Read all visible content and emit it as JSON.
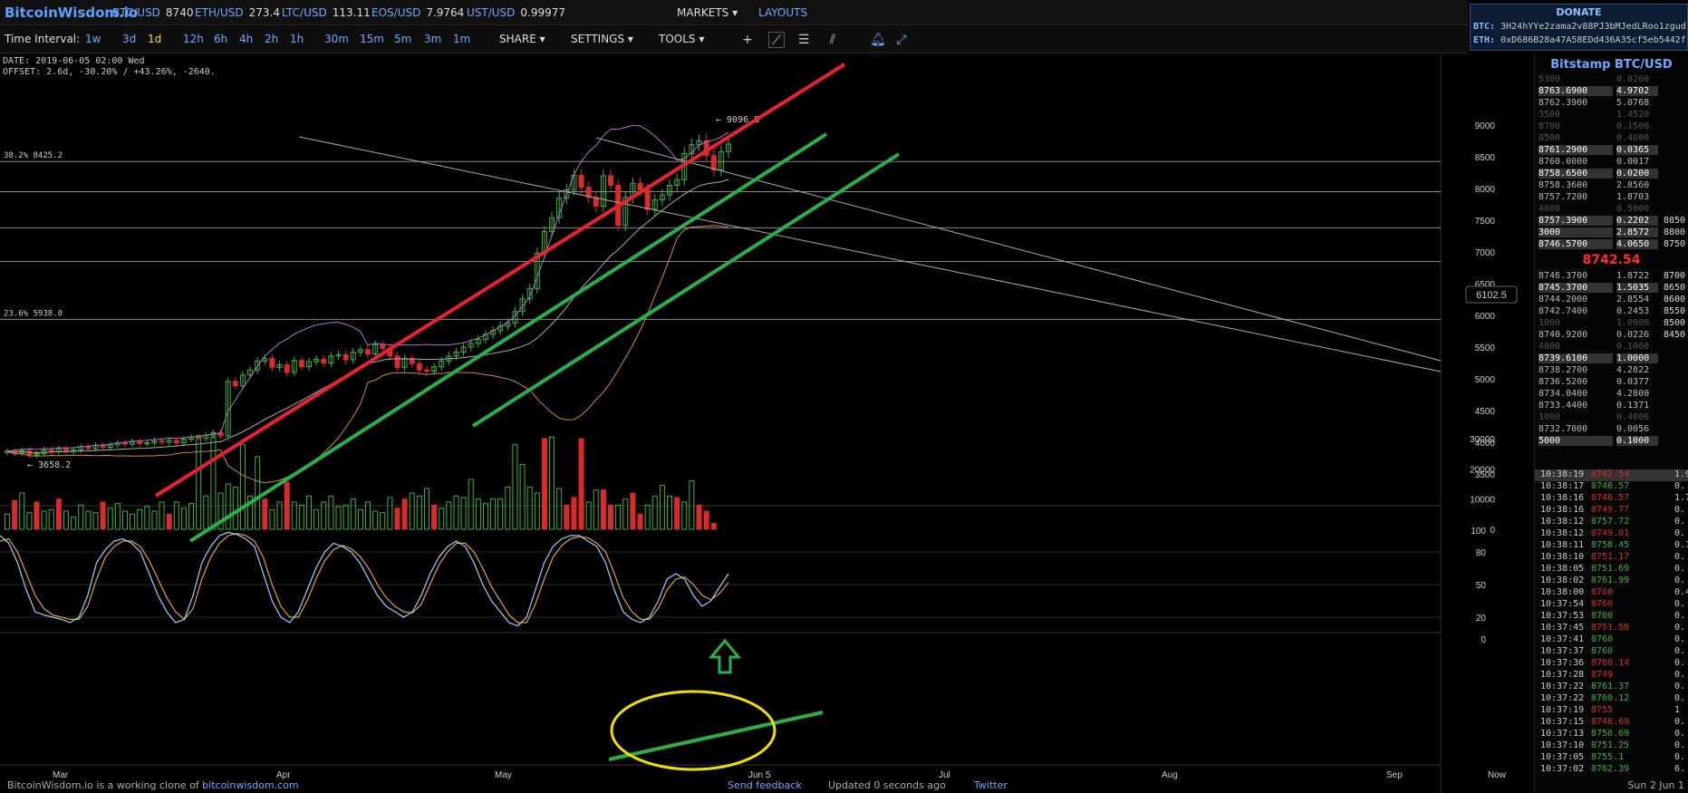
{
  "header": {
    "logo": "BitcoinWisdom.io",
    "tickers": [
      {
        "sym": "BTC/USD",
        "val": "8740"
      },
      {
        "sym": "ETH/USD",
        "val": "273.4"
      },
      {
        "sym": "LTC/USD",
        "val": "113.11"
      },
      {
        "sym": "EOS/USD",
        "val": "7.9764"
      },
      {
        "sym": "UST/USD",
        "val": "0.99977"
      }
    ],
    "markets": "MARKETS",
    "layouts": "LAYOUTS"
  },
  "donate": {
    "title": "DONATE",
    "btc_label": "BTC:",
    "btc_addr": "3H24hYYe2zama2v88PJ3bMJedLRoo1zgud",
    "eth_label": "ETH:",
    "eth_addr": "0xD686B28a47A58EDd436A35cf5eb5442f"
  },
  "toolbar": {
    "interval_label": "Time Interval:",
    "intervals": [
      "1w",
      "3d",
      "1d",
      "12h",
      "6h",
      "4h",
      "2h",
      "1h",
      "30m",
      "15m",
      "5m",
      "3m",
      "1m"
    ],
    "active_interval": "1d",
    "menus": [
      "SHARE",
      "SETTINGS",
      "TOOLS"
    ]
  },
  "chart_info": {
    "date_line": "DATE: 2019-06-05 02:00 Wed",
    "offset_line": "OFFSET: 2.6d, -30.20% / +43.26%, -2640."
  },
  "chart_data": {
    "type": "candlestick",
    "x_labels": [
      "Mar",
      "Apr",
      "May",
      "Jun 5",
      "Jul",
      "Aug",
      "Sep",
      "Now"
    ],
    "price_axis": [
      9000,
      8500,
      8000,
      7500,
      7000,
      6500,
      6000,
      5500,
      5000,
      4500,
      4000,
      3500
    ],
    "volume_axis": [
      30000,
      20000,
      10000,
      0
    ],
    "osc_axis": [
      100,
      80,
      50,
      20,
      0
    ],
    "fib_levels": [
      {
        "label": "38.2% 8425.2",
        "value": 8425.2
      },
      {
        "label": "23.6% 5938.0",
        "value": 5938.0
      }
    ],
    "hlines": [
      7950,
      7380,
      6850
    ],
    "high_marker": "← 9096.8",
    "low_marker": "← 3658.2",
    "cursor_price": "6102.5",
    "close_series": [
      3860,
      3830,
      3870,
      3800,
      3820,
      3880,
      3850,
      3900,
      3860,
      3880,
      3930,
      3900,
      3950,
      3920,
      3960,
      3990,
      3970,
      4010,
      3980,
      3990,
      4020,
      4000,
      4030,
      3990,
      4050,
      4080,
      4060,
      4110,
      4150,
      4100,
      4960,
      4890,
      5060,
      5140,
      5280,
      5320,
      5180,
      5220,
      5100,
      5290,
      5190,
      5270,
      5310,
      5250,
      5360,
      5380,
      5300,
      5420,
      5460,
      5390,
      5540,
      5480,
      5360,
      5180,
      5320,
      5240,
      5140,
      5120,
      5190,
      5280,
      5360,
      5420,
      5500,
      5560,
      5620,
      5700,
      5760,
      5830,
      5880,
      6060,
      6260,
      6420,
      6980,
      7320,
      7540,
      7850,
      7980,
      8210,
      8020,
      7860,
      7720,
      8200,
      8050,
      7420,
      7860,
      8080,
      7980,
      7670,
      7820,
      7900,
      8050,
      8140,
      8550,
      8690,
      8750,
      8520,
      8290,
      8580,
      8700
    ],
    "volume_series": [
      5000,
      9500,
      12000,
      5500,
      9000,
      6000,
      6500,
      10000,
      6000,
      4000,
      8000,
      6000,
      5500,
      9000,
      7000,
      8500,
      6000,
      5000,
      6500,
      7500,
      6000,
      9000,
      5000,
      9000,
      7000,
      8500,
      31000,
      11000,
      30500,
      12000,
      15000,
      14000,
      28000,
      11000,
      24000,
      10000,
      6500,
      9000,
      15500,
      9000,
      8000,
      11000,
      6500,
      9000,
      11000,
      7500,
      8000,
      10000,
      6500,
      9000,
      6000,
      5500,
      10500,
      7000,
      10000,
      12000,
      11000,
      13500,
      8000,
      7000,
      9000,
      11000,
      10500,
      16500,
      10000,
      8500,
      10000,
      10000,
      14000,
      28000,
      21500,
      14000,
      12000,
      30000,
      30500,
      13500,
      8000,
      10500,
      30000,
      9000,
      13000,
      13000,
      8000,
      8000,
      10000,
      12000,
      5000,
      8000,
      11000,
      14500,
      11000,
      10500,
      9000,
      16000,
      8000,
      6000,
      2000
    ],
    "volume_red": [
      false,
      true,
      false,
      false,
      true,
      false,
      false,
      true,
      false,
      false,
      false,
      false,
      false,
      true,
      false,
      false,
      false,
      false,
      false,
      false,
      false,
      false,
      true,
      false,
      false,
      false,
      false,
      false,
      false,
      false,
      false,
      false,
      false,
      false,
      false,
      true,
      false,
      false,
      true,
      false,
      false,
      false,
      false,
      false,
      false,
      false,
      false,
      false,
      false,
      false,
      false,
      false,
      false,
      true,
      true,
      false,
      false,
      false,
      true,
      false,
      false,
      false,
      false,
      false,
      false,
      false,
      false,
      false,
      false,
      false,
      false,
      false,
      false,
      true,
      false,
      false,
      true,
      true,
      true,
      false,
      false,
      true,
      true,
      false,
      false,
      true,
      true,
      false,
      false,
      false,
      false,
      true,
      false,
      false,
      true,
      true,
      true,
      false,
      false
    ],
    "stoch_k": [
      95,
      88,
      70,
      45,
      25,
      22,
      20,
      18,
      15,
      20,
      40,
      70,
      82,
      90,
      92,
      88,
      80,
      60,
      40,
      25,
      15,
      18,
      40,
      70,
      85,
      95,
      98,
      96,
      92,
      85,
      60,
      35,
      20,
      15,
      25,
      45,
      65,
      80,
      88,
      85,
      80,
      70,
      55,
      40,
      30,
      25,
      20,
      25,
      40,
      60,
      75,
      85,
      90,
      85,
      70,
      50,
      35,
      25,
      15,
      12,
      20,
      45,
      70,
      85,
      92,
      95,
      95,
      90,
      85,
      70,
      45,
      25,
      18,
      15,
      20,
      35,
      55,
      60,
      55,
      40,
      30,
      35,
      48,
      60
    ],
    "stoch_d": [
      90,
      92,
      80,
      60,
      40,
      28,
      22,
      20,
      18,
      18,
      30,
      55,
      75,
      85,
      90,
      90,
      85,
      72,
      55,
      38,
      25,
      18,
      28,
      55,
      75,
      88,
      95,
      97,
      95,
      90,
      75,
      50,
      30,
      20,
      20,
      35,
      55,
      72,
      82,
      86,
      83,
      76,
      65,
      50,
      38,
      30,
      25,
      24,
      32,
      50,
      68,
      80,
      88,
      88,
      80,
      65,
      48,
      35,
      22,
      15,
      15,
      32,
      55,
      75,
      86,
      92,
      94,
      93,
      88,
      80,
      60,
      38,
      25,
      18,
      18,
      28,
      45,
      55,
      57,
      50,
      40,
      36,
      42,
      52
    ]
  },
  "orderbook": {
    "title": "Bitstamp BTC/USD",
    "asks": [
      {
        "p": "5300",
        "a": "0.0200",
        "hl": false
      },
      {
        "p": "8763.6900",
        "a": "4.9702",
        "hl": true
      },
      {
        "p": "8762.3900",
        "a": "5.0768",
        "hl": false
      },
      {
        "p": "3500",
        "a": "1.4520",
        "hl": false
      },
      {
        "p": "8700",
        "a": "0.1500",
        "hl": false
      },
      {
        "p": "8500",
        "a": "0.4000",
        "hl": false
      },
      {
        "p": "8761.2900",
        "a": "0.0365",
        "hl": true
      },
      {
        "p": "8760.0000",
        "a": "0.0017",
        "hl": false
      },
      {
        "p": "8758.6500",
        "a": "0.0200",
        "hl": true
      },
      {
        "p": "8758.3600",
        "a": "2.8560",
        "hl": false
      },
      {
        "p": "8757.7200",
        "a": "1.8703",
        "hl": false
      },
      {
        "p": "4800",
        "a": "0.5000",
        "hl": false
      },
      {
        "p": "8757.3900",
        "a": "0.2202",
        "hl": true,
        "x": "8850"
      },
      {
        "p": "3000",
        "a": "2.8572",
        "hl": true,
        "x": "8800"
      },
      {
        "p": "8746.5700",
        "a": "4.0650",
        "hl": true,
        "x": "8750"
      }
    ],
    "last": "8742.54",
    "bids": [
      {
        "p": "8746.3700",
        "a": "1.8722",
        "hl": false,
        "x": "8700"
      },
      {
        "p": "8745.3700",
        "a": "1.5035",
        "hl": true,
        "x": "8650"
      },
      {
        "p": "8744.2000",
        "a": "2.8554",
        "hl": false,
        "x": "8600"
      },
      {
        "p": "8742.7400",
        "a": "0.2453",
        "hl": false,
        "x": "8550"
      },
      {
        "p": "1000",
        "a": "1.0000",
        "hl": false,
        "x": "8500"
      },
      {
        "p": "8740.9200",
        "a": "0.0226",
        "hl": false,
        "x": "8450"
      },
      {
        "p": "4800",
        "a": "0.1000",
        "hl": false
      },
      {
        "p": "8739.6100",
        "a": "1.0000",
        "hl": true
      },
      {
        "p": "8738.2700",
        "a": "4.2822",
        "hl": false
      },
      {
        "p": "8736.5200",
        "a": "0.0377",
        "hl": false
      },
      {
        "p": "8734.0400",
        "a": "4.2800",
        "hl": false
      },
      {
        "p": "8733.4400",
        "a": "0.1371",
        "hl": false
      },
      {
        "p": "1000",
        "a": "0.4000",
        "hl": false
      },
      {
        "p": "8732.7000",
        "a": "0.0056",
        "hl": false
      },
      {
        "p": "5000",
        "a": "0.1000",
        "hl": true
      }
    ]
  },
  "trades": [
    {
      "t": "10:38:19",
      "p": "8742.54",
      "a": "1.9",
      "c": "red",
      "hl": true
    },
    {
      "t": "10:38:17",
      "p": "8746.57",
      "a": "0.",
      "c": "green"
    },
    {
      "t": "10:38:16",
      "p": "8746.57",
      "a": "1.7",
      "c": "red"
    },
    {
      "t": "10:38:16",
      "p": "8749.77",
      "a": "0.",
      "c": "red"
    },
    {
      "t": "10:38:12",
      "p": "8757.72",
      "a": "0.",
      "c": "green"
    },
    {
      "t": "10:38:12",
      "p": "8749.01",
      "a": "0.",
      "c": "red"
    },
    {
      "t": "10:38:11",
      "p": "8758.45",
      "a": "0.1",
      "c": "green"
    },
    {
      "t": "10:38:10",
      "p": "8751.17",
      "a": "0.",
      "c": "red"
    },
    {
      "t": "10:38:05",
      "p": "8751.69",
      "a": "0.",
      "c": "green"
    },
    {
      "t": "10:38:02",
      "p": "8761.99",
      "a": "0.",
      "c": "green"
    },
    {
      "t": "10:38:00",
      "p": "8760",
      "a": "0.4",
      "c": "red"
    },
    {
      "t": "10:37:54",
      "p": "8760",
      "a": "0.",
      "c": "red"
    },
    {
      "t": "10:37:53",
      "p": "8760",
      "a": "0.",
      "c": "green"
    },
    {
      "t": "10:37:45",
      "p": "8751.58",
      "a": "0.",
      "c": "red"
    },
    {
      "t": "10:37:41",
      "p": "8760",
      "a": "0.",
      "c": "green"
    },
    {
      "t": "10:37:37",
      "p": "8760",
      "a": "0.",
      "c": "green"
    },
    {
      "t": "10:37:36",
      "p": "8760.14",
      "a": "0.",
      "c": "red"
    },
    {
      "t": "10:37:28",
      "p": "8749",
      "a": "0.",
      "c": "red"
    },
    {
      "t": "10:37:22",
      "p": "8761.37",
      "a": "0.",
      "c": "green"
    },
    {
      "t": "10:37:22",
      "p": "8760.12",
      "a": "0.",
      "c": "green"
    },
    {
      "t": "10:37:19",
      "p": "8755",
      "a": "1",
      "c": "red"
    },
    {
      "t": "10:37:15",
      "p": "8748.69",
      "a": "0.",
      "c": "red"
    },
    {
      "t": "10:37:13",
      "p": "8750.69",
      "a": "0.",
      "c": "green"
    },
    {
      "t": "10:37:10",
      "p": "8751.25",
      "a": "0.",
      "c": "green"
    },
    {
      "t": "10:37:05",
      "p": "8755.1",
      "a": "0.",
      "c": "green"
    },
    {
      "t": "10:37:02",
      "p": "8762.39",
      "a": "6.",
      "c": "green"
    }
  ],
  "footer": {
    "text": "BitcoinWisdom.io is a working clone of",
    "link": "bitcoinwisdom.com",
    "feedback": "Send feedback",
    "updated": "Updated 0 seconds ago",
    "twitter": "Twitter",
    "datetime": "Sun 2 Jun 1"
  },
  "colors": {
    "up": "#3db23d",
    "down": "#d92b2b",
    "accent": "#5aa0ff",
    "trend_red": "#e8232f",
    "trend_green": "#29b04a",
    "ellipse": "#f0e000"
  }
}
